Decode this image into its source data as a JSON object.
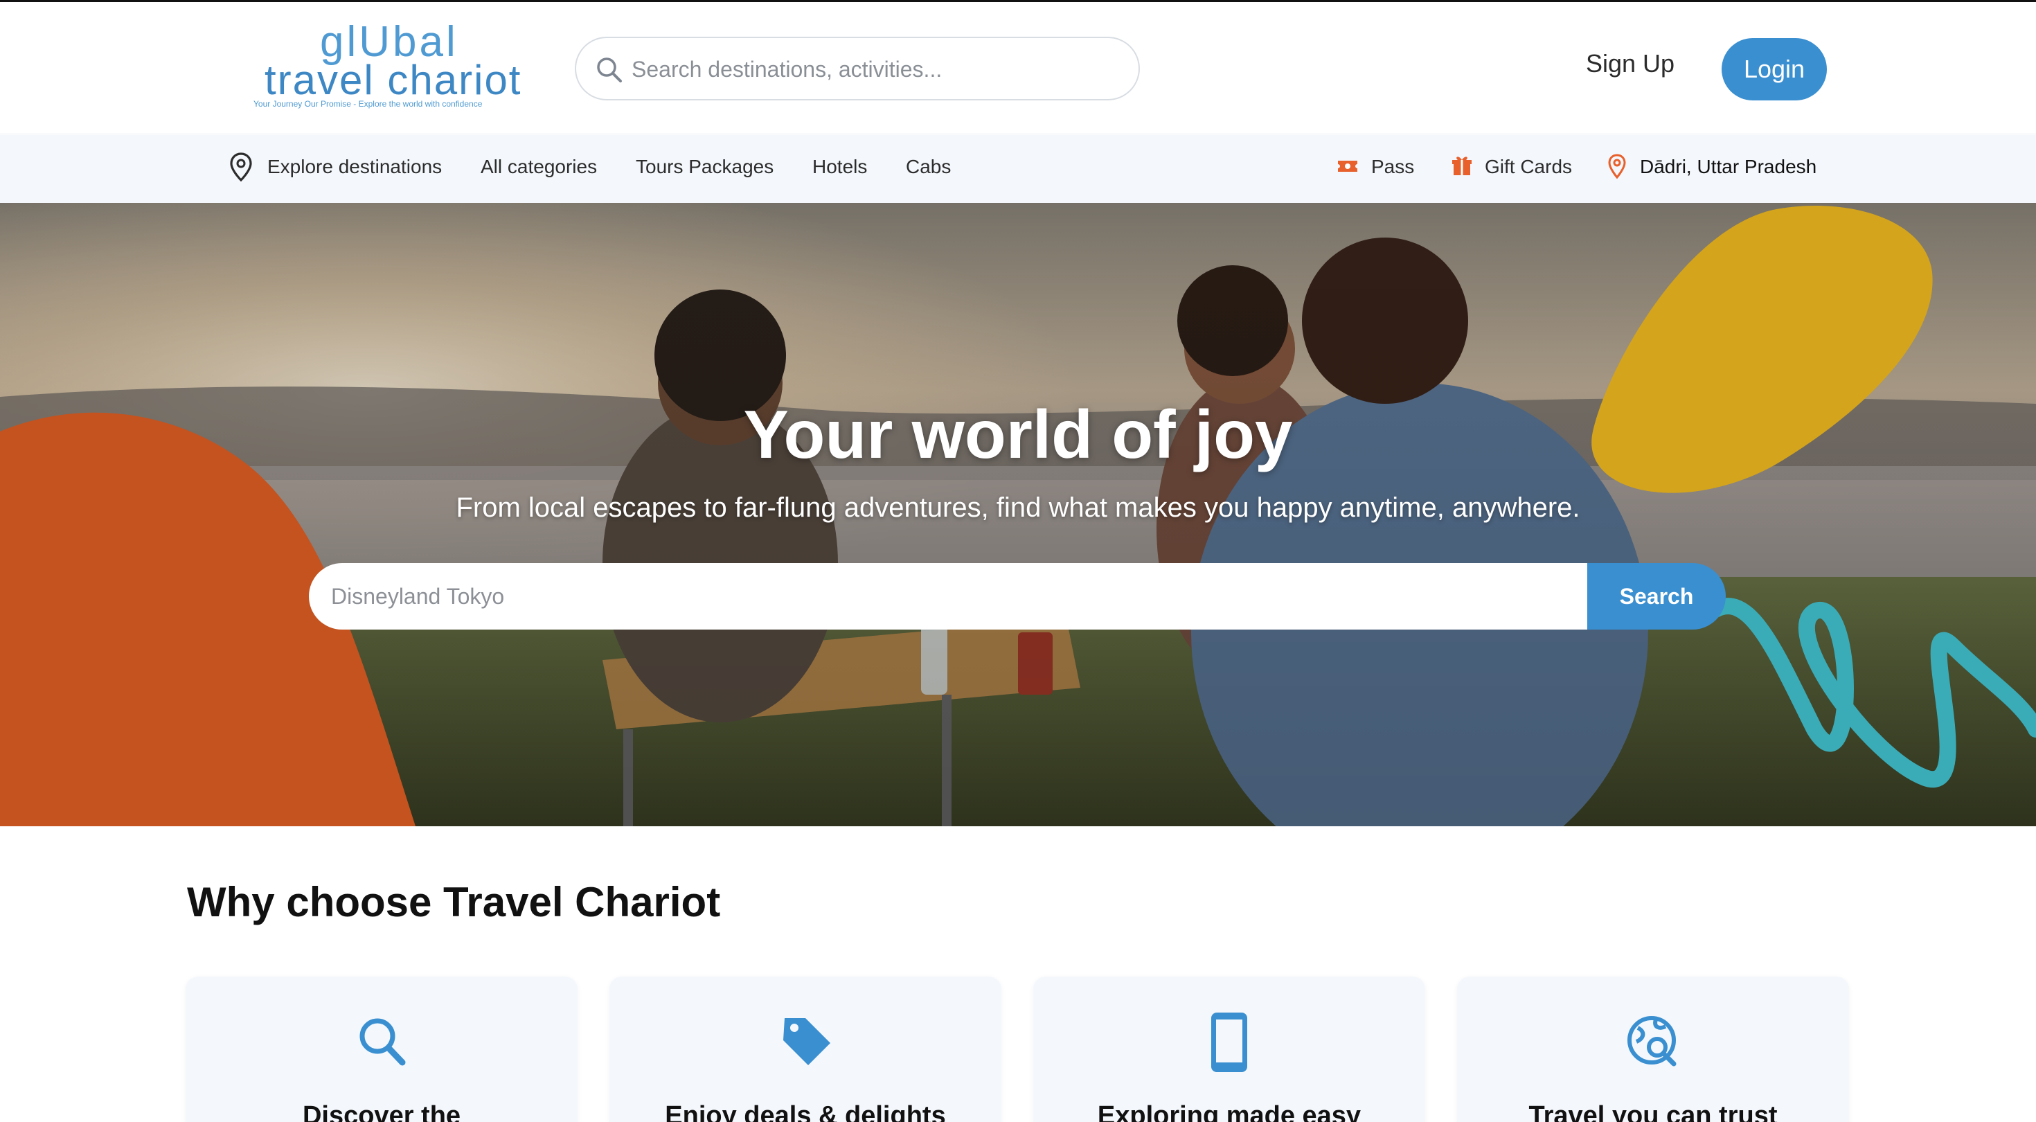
{
  "brand": {
    "logo_line1": "glUbal",
    "logo_line2": "travel chariot",
    "tagline": "Your Journey Our Promise - Explore the world with confidence"
  },
  "header": {
    "search_placeholder": "Search destinations, activities...",
    "signup_label": "Sign Up",
    "login_label": "Login"
  },
  "nav": {
    "left_items": [
      {
        "label": "Explore destinations",
        "icon": "location-pin-icon"
      },
      {
        "label": "All categories"
      },
      {
        "label": "Tours Packages"
      },
      {
        "label": "Hotels"
      },
      {
        "label": "Cabs"
      }
    ],
    "right_items": [
      {
        "label": "Pass",
        "icon": "ticket-icon"
      },
      {
        "label": "Gift Cards",
        "icon": "gift-icon"
      },
      {
        "label": "Dādri, Uttar Pradesh",
        "icon": "location-pin-icon"
      }
    ]
  },
  "hero": {
    "title": "Your world of joy",
    "subtitle": "From local escapes to far-flung adventures, find what makes you happy anytime, anywhere.",
    "search_placeholder": "Disneyland Tokyo",
    "search_button": "Search"
  },
  "why": {
    "title": "Why choose Travel Chariot",
    "cards": [
      {
        "title": "Discover the",
        "icon": "search-icon"
      },
      {
        "title": "Enjoy deals & delights",
        "icon": "tag-icon"
      },
      {
        "title": "Exploring made easy",
        "icon": "smartphone-icon"
      },
      {
        "title": "Travel you can trust",
        "icon": "globe-search-icon"
      }
    ]
  },
  "colors": {
    "primary": "#3a8fd0",
    "accent_orange": "#e8602c",
    "blob_orange": "#c4531f",
    "blob_yellow": "#d4a41c",
    "squiggle_teal": "#3aacb8",
    "nav_bg": "#f4f8fc"
  }
}
